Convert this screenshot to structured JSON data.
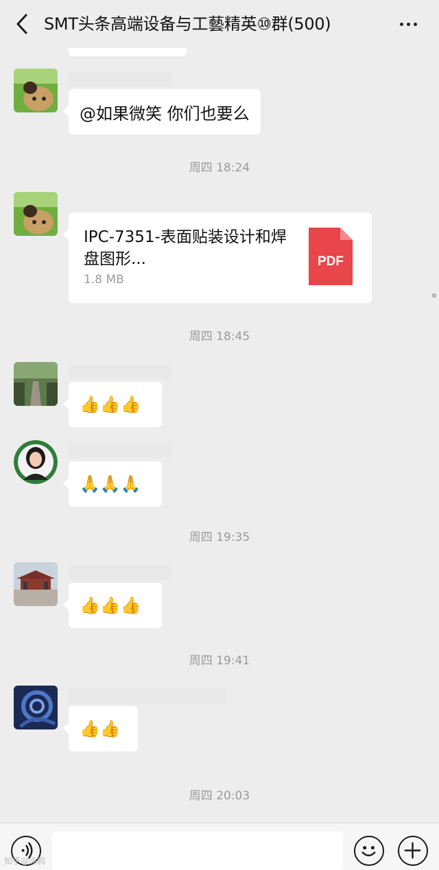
{
  "header": {
    "title": "SMT头条高端设备与工藝精英⑩群(500)",
    "back_icon": "chevron-left-icon",
    "more_icon": "more-dots-icon"
  },
  "messages": [
    {
      "type": "text",
      "text": "@如果微笑  你们也要么",
      "avatar": "cat-dog-avatar"
    },
    {
      "type": "time",
      "text": "周四 18:24"
    },
    {
      "type": "file",
      "file_name": "IPC-7351-表面贴装设计和焊盘图形...",
      "file_size": "1.8 MB",
      "file_icon": "pdf-icon",
      "file_icon_label": "PDF",
      "avatar": "cat-dog-avatar"
    },
    {
      "type": "time",
      "text": "周四 18:45"
    },
    {
      "type": "emoji",
      "emoji": "👍👍👍",
      "avatar": "stone-path-avatar"
    },
    {
      "type": "emoji",
      "emoji": "🙏🙏🙏",
      "avatar": "woman-portrait-avatar"
    },
    {
      "type": "time",
      "text": "周四 19:35"
    },
    {
      "type": "emoji",
      "emoji": "👍👍👍",
      "avatar": "pavilion-avatar"
    },
    {
      "type": "time",
      "text": "周四 19:41"
    },
    {
      "type": "emoji",
      "emoji": "👍👍",
      "avatar": "blue-swirl-avatar"
    },
    {
      "type": "time",
      "text": "周四 20:03"
    }
  ],
  "input_bar": {
    "voice_icon": "voice-icon",
    "emoji_icon": "smiley-icon",
    "plus_icon": "plus-icon",
    "input_value": ""
  },
  "watermark": "知乎@涂鸦"
}
